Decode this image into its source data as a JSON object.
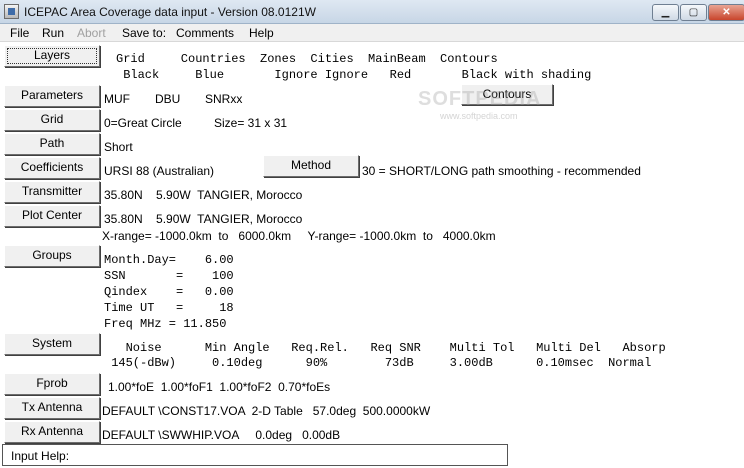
{
  "window": {
    "title": "ICEPAC Area Coverage data input - Version 08.0121W",
    "minimize": "▁",
    "maximize": "▢",
    "close": "✕"
  },
  "menu": [
    "File",
    "Run",
    "Abort",
    "Save to:",
    "Comments",
    "Help"
  ],
  "buttons": {
    "layers": "Layers",
    "parameters": "Parameters",
    "grid": "Grid",
    "path": "Path",
    "coefficients": "Coefficients",
    "transmitter": "Transmitter",
    "plot_center": "Plot Center",
    "groups": "Groups",
    "system": "System",
    "fprob": "Fprob",
    "tx_antenna": "Tx Antenna",
    "rx_antenna": "Rx Antenna",
    "method": "Method",
    "contours": "Contours"
  },
  "layers": {
    "headers": "Grid     Countries  Zones  Cities  MainBeam  Contours",
    "values": " Black     Blue       Ignore Ignore   Red       Black with shading"
  },
  "parameters": {
    "muf": "MUF",
    "dbu": "DBU",
    "snr": "SNRxx"
  },
  "grid": {
    "path_type": "0=Great Circle",
    "size": "Size= 31 x 31"
  },
  "path": {
    "value": "Short"
  },
  "coefficients": {
    "value": "URSI 88 (Australian)",
    "method_desc": "30 = SHORT/LONG path smoothing - recommended"
  },
  "transmitter": {
    "value": "35.80N    5.90W  TANGIER, Morocco"
  },
  "plot_center": {
    "value": "35.80N    5.90W  TANGIER, Morocco"
  },
  "range": {
    "value": "X-range= -1000.0km  to   6000.0km     Y-range= -1000.0km  to   4000.0km"
  },
  "groups": {
    "lines": [
      "Month.Day=    6.00",
      "SSN       =    100",
      "Qindex    =   0.00",
      "Time UT   =     18",
      "Freq MHz = 11.850"
    ]
  },
  "system": {
    "headers": "   Noise      Min Angle   Req.Rel.   Req SNR    Multi Tol   Multi Del   Absorp",
    "values": " 145(-dBw)     0.10deg      90%        73dB     3.00dB      0.10msec  Normal"
  },
  "fprob": {
    "value": "1.00*foE  1.00*foF1  1.00*foF2  0.70*foEs"
  },
  "tx_antenna": {
    "value": "DEFAULT \\CONST17.VOA  2-D Table   57.0deg  500.0000kW"
  },
  "rx_antenna": {
    "value": "DEFAULT \\SWWHIP.VOA     0.0deg   0.00dB"
  },
  "input_help": {
    "label": "Input Help:"
  },
  "watermark": {
    "logo": "SOFTPEDIA",
    "url": "www.softpedia.com"
  }
}
